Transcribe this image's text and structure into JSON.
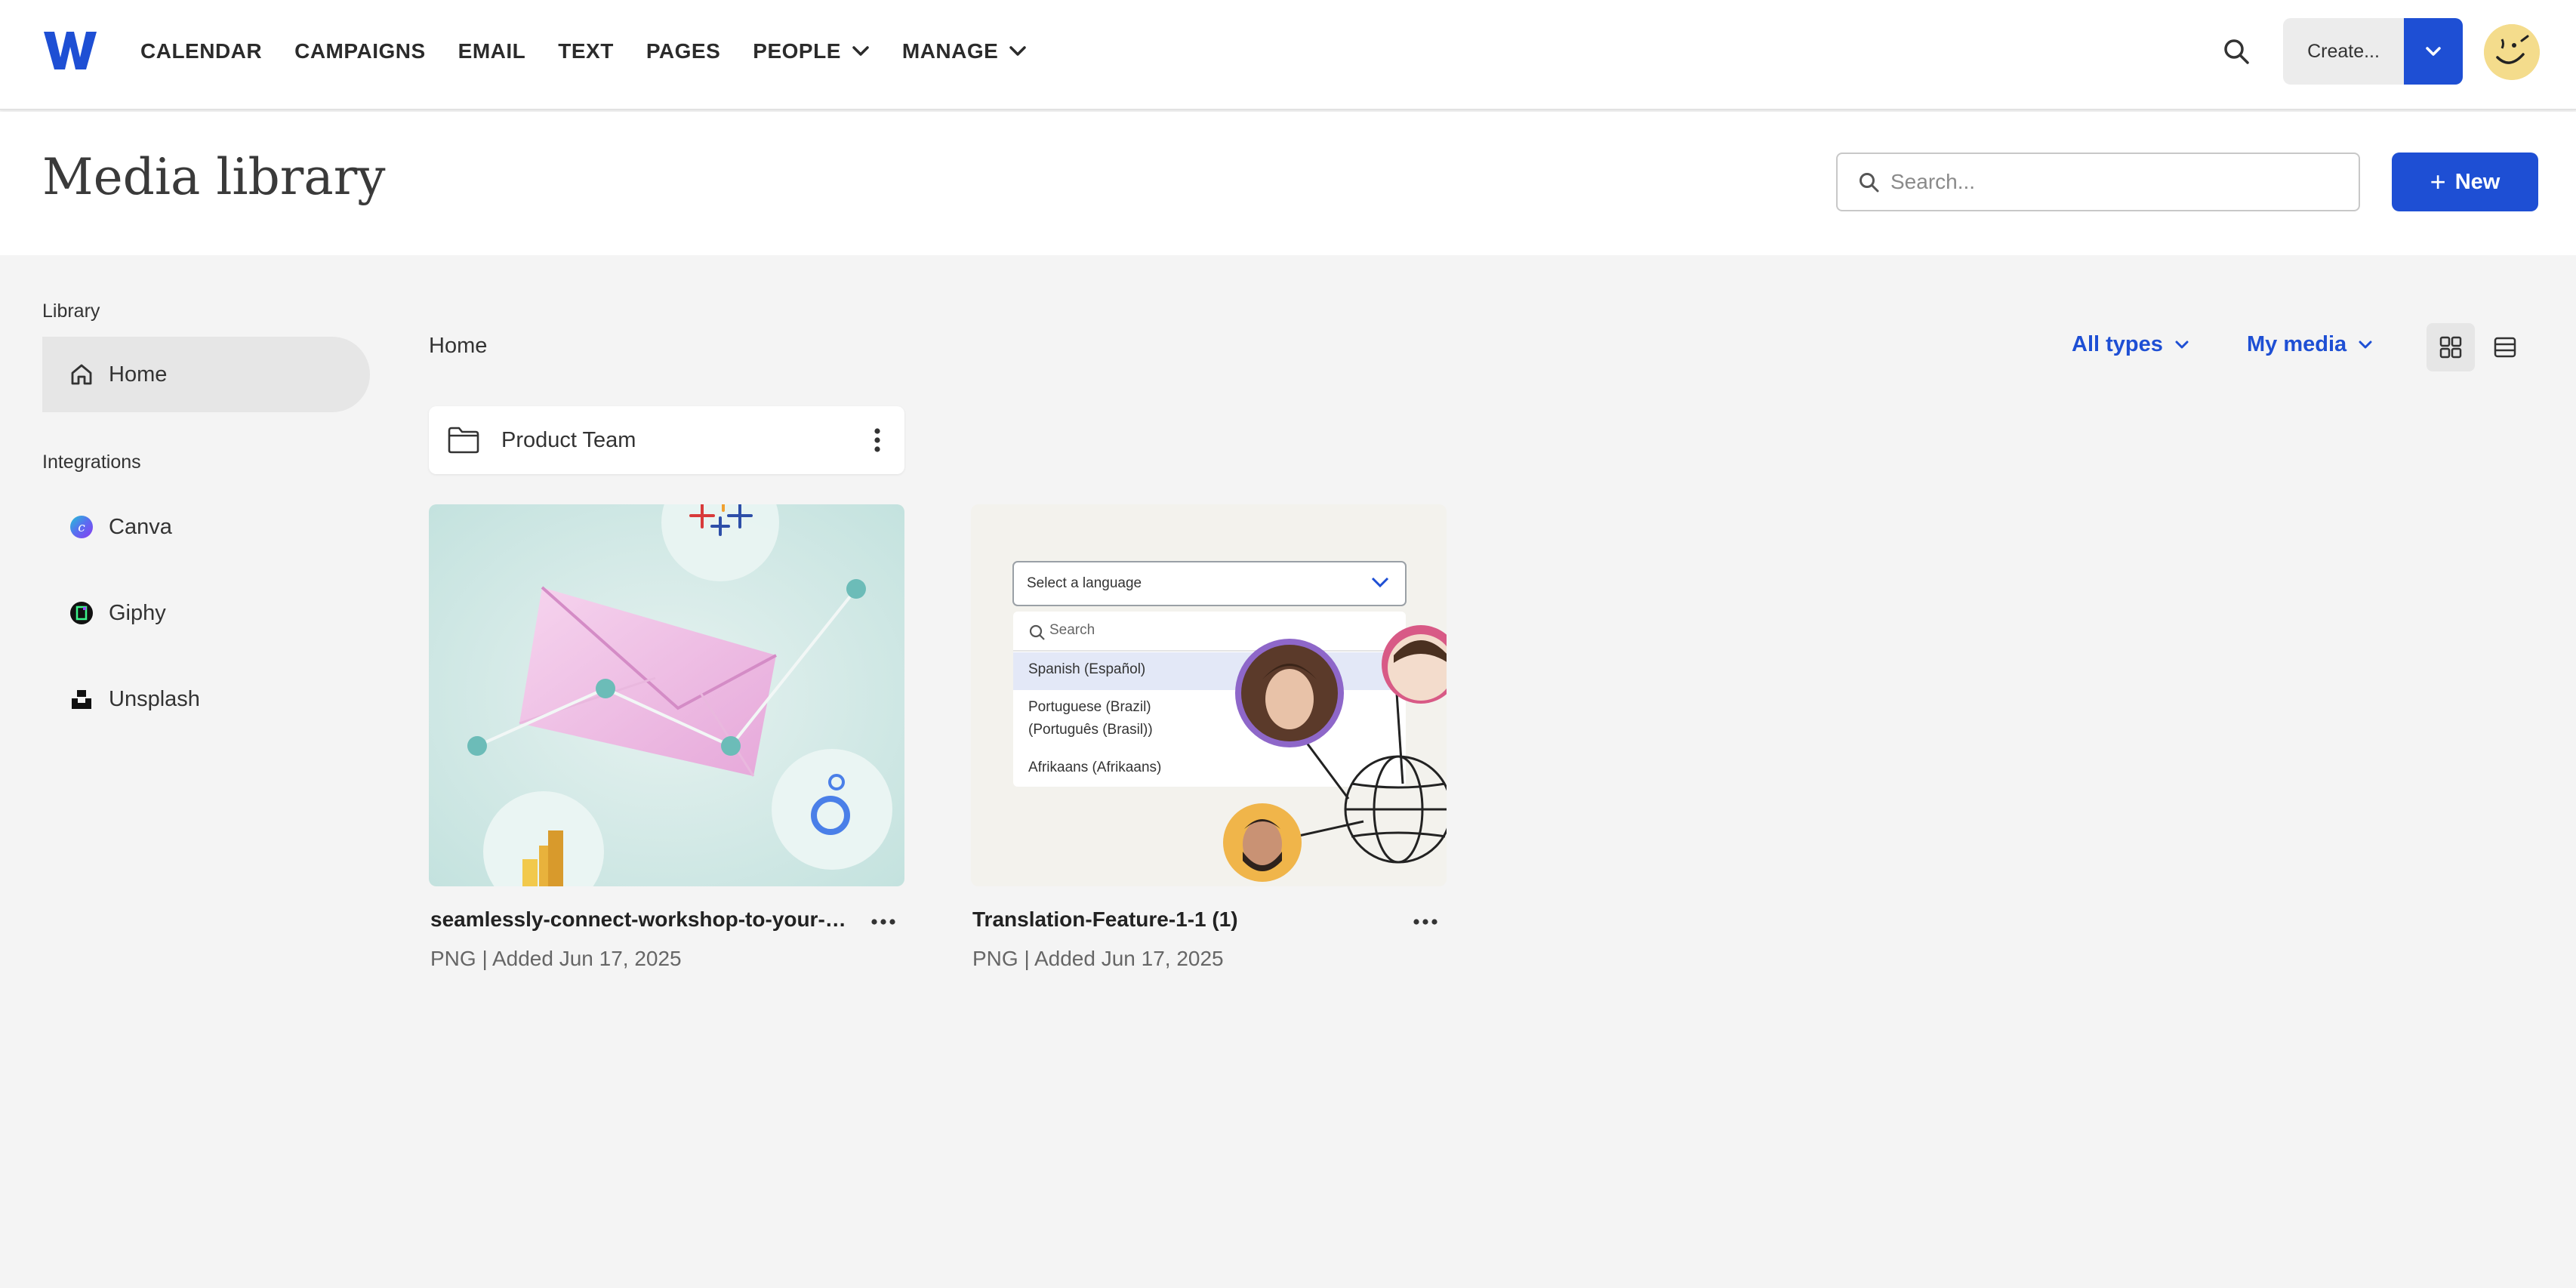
{
  "nav": {
    "items": [
      {
        "label": "CALENDAR",
        "has_caret": false
      },
      {
        "label": "CAMPAIGNS",
        "has_caret": false
      },
      {
        "label": "EMAIL",
        "has_caret": false
      },
      {
        "label": "TEXT",
        "has_caret": false
      },
      {
        "label": "PAGES",
        "has_caret": false
      },
      {
        "label": "PEOPLE",
        "has_caret": true
      },
      {
        "label": "MANAGE",
        "has_caret": true
      }
    ],
    "create_label": "Create..."
  },
  "header": {
    "title": "Media library",
    "search_placeholder": "Search...",
    "new_label": "New"
  },
  "sidebar": {
    "library_heading": "Library",
    "home_label": "Home",
    "integrations_heading": "Integrations",
    "integrations": [
      {
        "label": "Canva",
        "icon": "canva-icon"
      },
      {
        "label": "Giphy",
        "icon": "giphy-icon"
      },
      {
        "label": "Unsplash",
        "icon": "unsplash-icon"
      }
    ]
  },
  "main": {
    "breadcrumb": "Home",
    "filter_types": "All types",
    "filter_owner": "My media",
    "folders": [
      {
        "name": "Product Team"
      }
    ],
    "media": [
      {
        "title": "seamlessly-connect-workshop-to-your-bu...",
        "meta": "PNG | Added Jun 17, 2025"
      },
      {
        "title": "Translation-Feature-1-1 (1)",
        "meta": "PNG | Added Jun 17, 2025"
      }
    ],
    "thumb2": {
      "select_label": "Select a language",
      "search_label": "Search",
      "options": [
        "Spanish (Español)",
        "Portuguese (Brazil)",
        "(Português (Brasil))",
        "Afrikaans (Afrikaans)"
      ]
    }
  },
  "colors": {
    "accent": "#1e4fd4",
    "active_bg": "#e6e6e6",
    "page_bg": "#f4f4f4"
  }
}
